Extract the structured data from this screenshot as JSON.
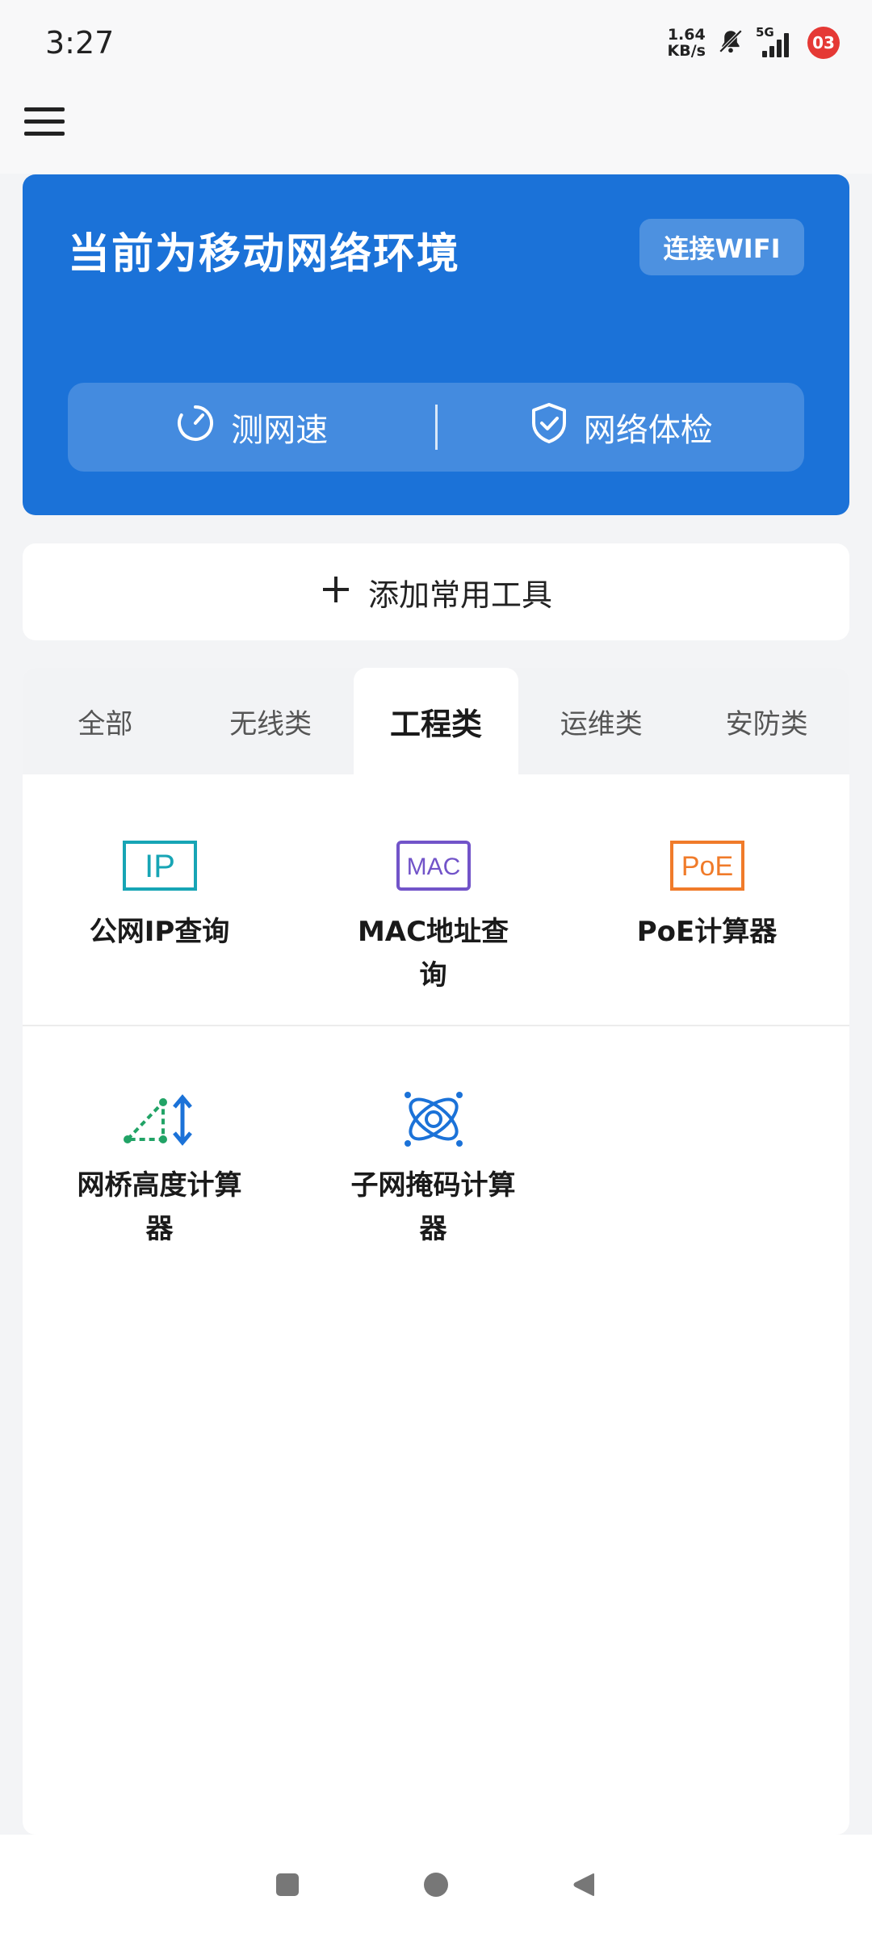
{
  "status_bar": {
    "time": "3:27",
    "net_speed_value": "1.64",
    "net_speed_unit": "KB/s",
    "network_type": "5G",
    "notification_badge": "03"
  },
  "hero": {
    "title": "当前为移动网络环境",
    "connect_wifi_label": "连接WIFI",
    "speed_test_label": "测网速",
    "network_check_label": "网络体检"
  },
  "add_tools": {
    "label": "添加常用工具"
  },
  "tabs": [
    {
      "label": "全部",
      "active": false
    },
    {
      "label": "无线类",
      "active": false
    },
    {
      "label": "工程类",
      "active": true
    },
    {
      "label": "运维类",
      "active": false
    },
    {
      "label": "安防类",
      "active": false
    }
  ],
  "tools": [
    {
      "label": "公网IP查询",
      "icon": "ip-icon",
      "icon_text": "IP",
      "color": "#17a5b5"
    },
    {
      "label": "MAC地址查询",
      "icon": "mac-icon",
      "icon_text": "MAC",
      "color": "#7254c9"
    },
    {
      "label": "PoE计算器",
      "icon": "poe-icon",
      "icon_text": "PoE",
      "color": "#f07b2a"
    },
    {
      "label": "网桥高度计算器",
      "icon": "bridge-height-icon",
      "color": "#21a366"
    },
    {
      "label": "子网掩码计算器",
      "icon": "subnet-mask-icon",
      "color": "#1b72d8"
    }
  ],
  "colors": {
    "hero_blue": "#1b72d8",
    "badge_red": "#e53935"
  }
}
